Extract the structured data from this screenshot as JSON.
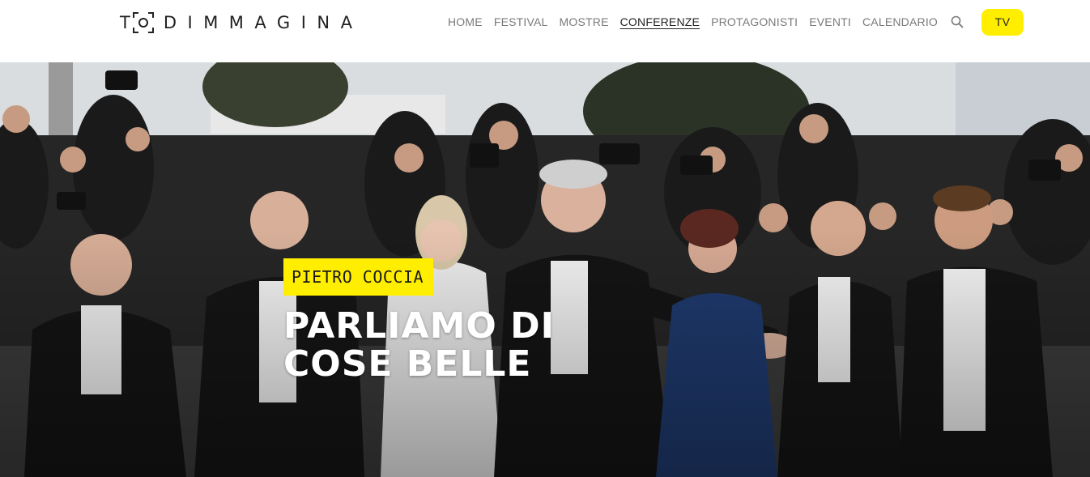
{
  "brand": {
    "name": "TODIMMAGINA",
    "logo_first_letter": "T",
    "logo_rest": "DIMMAGINA",
    "accent_color": "#ffee00"
  },
  "nav": {
    "items": [
      {
        "label": "HOME",
        "active": false
      },
      {
        "label": "FESTIVAL",
        "active": false
      },
      {
        "label": "MOSTRE",
        "active": false
      },
      {
        "label": "CONFERENZE",
        "active": true
      },
      {
        "label": "PROTAGONISTI",
        "active": false
      },
      {
        "label": "EVENTI",
        "active": false
      },
      {
        "label": "CALENDARIO",
        "active": false
      }
    ],
    "search_icon": "search-icon",
    "tv_label": "TV"
  },
  "hero": {
    "author": "PIETRO COCCIA",
    "title": "PARLIAMO DI COSE BELLE",
    "image_description_icon": "red-carpet-photo"
  }
}
